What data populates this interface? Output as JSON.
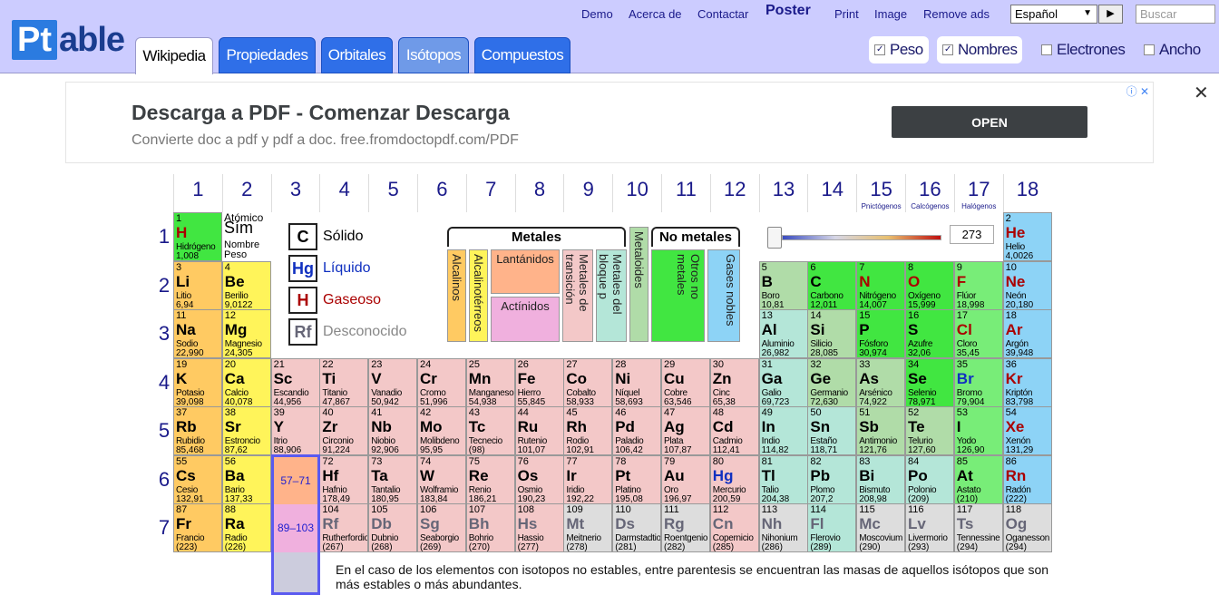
{
  "header": {
    "logo_pt": "Pt",
    "logo_rest": "able",
    "links": [
      "Demo",
      "Acerca de",
      "Contactar"
    ],
    "poster": "Poster",
    "links2": [
      "Print",
      "Image",
      "Remove ads"
    ],
    "language": "Español",
    "search_placeholder": "Buscar",
    "tabs": [
      "Wikipedia",
      "Propiedades",
      "Orbitales",
      "Isótopos",
      "Compuestos"
    ],
    "checks": [
      {
        "label": "Peso",
        "on": true
      },
      {
        "label": "Nombres",
        "on": true
      },
      {
        "label": "Electrones",
        "on": false
      },
      {
        "label": "Ancho",
        "on": false
      }
    ]
  },
  "ad": {
    "title": "Descarga a PDF - Comenzar Descarga",
    "subtitle": "Convierte doc a pdf y pdf a doc. free.fromdoctopdf.com/PDF",
    "button": "OPEN",
    "close": "✕"
  },
  "groups": [
    "1",
    "2",
    "3",
    "4",
    "5",
    "6",
    "7",
    "8",
    "9",
    "10",
    "11",
    "12",
    "13",
    "14",
    "15",
    "16",
    "17",
    "18"
  ],
  "group_sub": {
    "15": "Pnictógenos",
    "16": "Calcógenos",
    "17": "Halógenos"
  },
  "periods": [
    "1",
    "2",
    "3",
    "4",
    "5",
    "6",
    "7"
  ],
  "key": {
    "n": "1",
    "s": "Sím",
    "atomic": "Atómico",
    "name": "Nombre",
    "weight": "Peso"
  },
  "legend": {
    "solid": "Sólido",
    "liquid": "Líquido",
    "gas": "Gaseoso",
    "unknown": "Desconocido",
    "sw": [
      "C",
      "Hg",
      "H",
      "Rf"
    ]
  },
  "categories": {
    "metals": "Metales",
    "nonmetals": "No metales",
    "alk": "Alcalinos",
    "ear": "Alcalinotérreos",
    "lan": "Lantánidos",
    "act": "Actínidos",
    "pm": "Metales de transición",
    "mtl": "Metales del bloque p",
    "metalloids": "Metaloides",
    "ona": "Otros no metales",
    "nob": "Gases nobles"
  },
  "temperature": "273",
  "lan_range": "57–71",
  "act_range": "89–103",
  "note": "En el caso de los elementos con isotopos no estables, entre parentesis se encuentran las masas de aquellos isótopos que son más estables o más abundantes.",
  "elements": [
    [
      "1",
      "H",
      "Hidrógeno",
      "1,008",
      1,
      1,
      "ona",
      "gas"
    ],
    [
      "2",
      "He",
      "Helio",
      "4,0026",
      18,
      1,
      "nob",
      "gas"
    ],
    [
      "3",
      "Li",
      "Litio",
      "6,94",
      1,
      2,
      "alk",
      ""
    ],
    [
      "4",
      "Be",
      "Berilio",
      "9,0122",
      2,
      2,
      "ear",
      ""
    ],
    [
      "5",
      "B",
      "Boro",
      "10,81",
      13,
      2,
      "mtl",
      ""
    ],
    [
      "6",
      "C",
      "Carbono",
      "12,011",
      14,
      2,
      "ona",
      ""
    ],
    [
      "7",
      "N",
      "Nitrógeno",
      "14,007",
      15,
      2,
      "ona",
      "gas"
    ],
    [
      "8",
      "O",
      "Oxígeno",
      "15,999",
      16,
      2,
      "ona",
      "gas"
    ],
    [
      "9",
      "F",
      "Flúor",
      "18,998",
      17,
      2,
      "hal",
      "gas"
    ],
    [
      "10",
      "Ne",
      "Neón",
      "20,180",
      18,
      2,
      "nob",
      "gas"
    ],
    [
      "11",
      "Na",
      "Sodio",
      "22,990",
      1,
      3,
      "alk",
      ""
    ],
    [
      "12",
      "Mg",
      "Magnesio",
      "24,305",
      2,
      3,
      "ear",
      ""
    ],
    [
      "13",
      "Al",
      "Aluminio",
      "26,982",
      13,
      3,
      "pm",
      ""
    ],
    [
      "14",
      "Si",
      "Silicio",
      "28,085",
      14,
      3,
      "mtl",
      ""
    ],
    [
      "15",
      "P",
      "Fósforo",
      "30,974",
      15,
      3,
      "ona",
      ""
    ],
    [
      "16",
      "S",
      "Azufre",
      "32,06",
      16,
      3,
      "ona",
      ""
    ],
    [
      "17",
      "Cl",
      "Cloro",
      "35,45",
      17,
      3,
      "hal",
      "gas"
    ],
    [
      "18",
      "Ar",
      "Argón",
      "39,948",
      18,
      3,
      "nob",
      "gas"
    ],
    [
      "19",
      "K",
      "Potasio",
      "39,098",
      1,
      4,
      "alk",
      ""
    ],
    [
      "20",
      "Ca",
      "Calcio",
      "40,078",
      2,
      4,
      "ear",
      ""
    ],
    [
      "21",
      "Sc",
      "Escandio",
      "44,956",
      3,
      4,
      "tm",
      ""
    ],
    [
      "22",
      "Ti",
      "Titanio",
      "47,867",
      4,
      4,
      "tm",
      ""
    ],
    [
      "23",
      "V",
      "Vanadio",
      "50,942",
      5,
      4,
      "tm",
      ""
    ],
    [
      "24",
      "Cr",
      "Cromo",
      "51,996",
      6,
      4,
      "tm",
      ""
    ],
    [
      "25",
      "Mn",
      "Manganeso",
      "54,938",
      7,
      4,
      "tm",
      ""
    ],
    [
      "26",
      "Fe",
      "Hierro",
      "55,845",
      8,
      4,
      "tm",
      ""
    ],
    [
      "27",
      "Co",
      "Cobalto",
      "58,933",
      9,
      4,
      "tm",
      ""
    ],
    [
      "28",
      "Ni",
      "Níquel",
      "58,693",
      10,
      4,
      "tm",
      ""
    ],
    [
      "29",
      "Cu",
      "Cobre",
      "63,546",
      11,
      4,
      "tm",
      ""
    ],
    [
      "30",
      "Zn",
      "Cinc",
      "65,38",
      12,
      4,
      "tm",
      ""
    ],
    [
      "31",
      "Ga",
      "Galio",
      "69,723",
      13,
      4,
      "pm",
      ""
    ],
    [
      "32",
      "Ge",
      "Germanio",
      "72,630",
      14,
      4,
      "mtl",
      ""
    ],
    [
      "33",
      "As",
      "Arsénico",
      "74,922",
      15,
      4,
      "mtl",
      ""
    ],
    [
      "34",
      "Se",
      "Selenio",
      "78,971",
      16,
      4,
      "ona",
      ""
    ],
    [
      "35",
      "Br",
      "Bromo",
      "79,904",
      17,
      4,
      "hal",
      "liq"
    ],
    [
      "36",
      "Kr",
      "Kriptón",
      "83,798",
      18,
      4,
      "nob",
      "gas"
    ],
    [
      "37",
      "Rb",
      "Rubidio",
      "85,468",
      1,
      5,
      "alk",
      ""
    ],
    [
      "38",
      "Sr",
      "Estroncio",
      "87,62",
      2,
      5,
      "ear",
      ""
    ],
    [
      "39",
      "Y",
      "Itrio",
      "88,906",
      3,
      5,
      "tm",
      ""
    ],
    [
      "40",
      "Zr",
      "Circonio",
      "91,224",
      4,
      5,
      "tm",
      ""
    ],
    [
      "41",
      "Nb",
      "Niobio",
      "92,906",
      5,
      5,
      "tm",
      ""
    ],
    [
      "42",
      "Mo",
      "Molibdeno",
      "95,95",
      6,
      5,
      "tm",
      ""
    ],
    [
      "43",
      "Tc",
      "Tecnecio",
      "(98)",
      7,
      5,
      "tm",
      ""
    ],
    [
      "44",
      "Ru",
      "Rutenio",
      "101,07",
      8,
      5,
      "tm",
      ""
    ],
    [
      "45",
      "Rh",
      "Rodio",
      "102,91",
      9,
      5,
      "tm",
      ""
    ],
    [
      "46",
      "Pd",
      "Paladio",
      "106,42",
      10,
      5,
      "tm",
      ""
    ],
    [
      "47",
      "Ag",
      "Plata",
      "107,87",
      11,
      5,
      "tm",
      ""
    ],
    [
      "48",
      "Cd",
      "Cadmio",
      "112,41",
      12,
      5,
      "tm",
      ""
    ],
    [
      "49",
      "In",
      "Indio",
      "114,82",
      13,
      5,
      "pm",
      ""
    ],
    [
      "50",
      "Sn",
      "Estaño",
      "118,71",
      14,
      5,
      "pm",
      ""
    ],
    [
      "51",
      "Sb",
      "Antimonio",
      "121,76",
      15,
      5,
      "mtl",
      ""
    ],
    [
      "52",
      "Te",
      "Telurio",
      "127,60",
      16,
      5,
      "mtl",
      ""
    ],
    [
      "53",
      "I",
      "Yodo",
      "126,90",
      17,
      5,
      "hal",
      ""
    ],
    [
      "54",
      "Xe",
      "Xenón",
      "131,29",
      18,
      5,
      "nob",
      "gas"
    ],
    [
      "55",
      "Cs",
      "Cesio",
      "132,91",
      1,
      6,
      "alk",
      ""
    ],
    [
      "56",
      "Ba",
      "Bario",
      "137,33",
      2,
      6,
      "ear",
      ""
    ],
    [
      "72",
      "Hf",
      "Hafnio",
      "178,49",
      4,
      6,
      "tm",
      ""
    ],
    [
      "73",
      "Ta",
      "Tantalio",
      "180,95",
      5,
      6,
      "tm",
      ""
    ],
    [
      "74",
      "W",
      "Wolframio",
      "183,84",
      6,
      6,
      "tm",
      ""
    ],
    [
      "75",
      "Re",
      "Renio",
      "186,21",
      7,
      6,
      "tm",
      ""
    ],
    [
      "76",
      "Os",
      "Osmio",
      "190,23",
      8,
      6,
      "tm",
      ""
    ],
    [
      "77",
      "Ir",
      "Iridio",
      "192,22",
      9,
      6,
      "tm",
      ""
    ],
    [
      "78",
      "Pt",
      "Platino",
      "195,08",
      10,
      6,
      "tm",
      ""
    ],
    [
      "79",
      "Au",
      "Oro",
      "196,97",
      11,
      6,
      "tm",
      ""
    ],
    [
      "80",
      "Hg",
      "Mercurio",
      "200,59",
      12,
      6,
      "tm",
      "liq"
    ],
    [
      "81",
      "Tl",
      "Talio",
      "204,38",
      13,
      6,
      "pm",
      ""
    ],
    [
      "82",
      "Pb",
      "Plomo",
      "207,2",
      14,
      6,
      "pm",
      ""
    ],
    [
      "83",
      "Bi",
      "Bismuto",
      "208,98",
      15,
      6,
      "pm",
      ""
    ],
    [
      "84",
      "Po",
      "Polonio",
      "(209)",
      16,
      6,
      "pm",
      ""
    ],
    [
      "85",
      "At",
      "Astato",
      "(210)",
      17,
      6,
      "hal",
      ""
    ],
    [
      "86",
      "Rn",
      "Radón",
      "(222)",
      18,
      6,
      "nob",
      "gas"
    ],
    [
      "87",
      "Fr",
      "Francio",
      "(223)",
      1,
      7,
      "alk",
      ""
    ],
    [
      "88",
      "Ra",
      "Radio",
      "(226)",
      2,
      7,
      "ear",
      ""
    ],
    [
      "104",
      "Rf",
      "Rutherfordio",
      "(267)",
      4,
      7,
      "tm",
      "unk"
    ],
    [
      "105",
      "Db",
      "Dubnio",
      "(268)",
      5,
      7,
      "tm",
      "unk"
    ],
    [
      "106",
      "Sg",
      "Seaborgio",
      "(269)",
      6,
      7,
      "tm",
      "unk"
    ],
    [
      "107",
      "Bh",
      "Bohrio",
      "(270)",
      7,
      7,
      "tm",
      "unk"
    ],
    [
      "108",
      "Hs",
      "Hassio",
      "(277)",
      8,
      7,
      "tm",
      "unk"
    ],
    [
      "109",
      "Mt",
      "Meitnerio",
      "(278)",
      9,
      7,
      "unk",
      "unk"
    ],
    [
      "110",
      "Ds",
      "Darmstadtio",
      "(281)",
      10,
      7,
      "unk",
      "unk"
    ],
    [
      "111",
      "Rg",
      "Roentgenio",
      "(282)",
      11,
      7,
      "unk",
      "unk"
    ],
    [
      "112",
      "Cn",
      "Copernicio",
      "(285)",
      12,
      7,
      "tm",
      "unk"
    ],
    [
      "113",
      "Nh",
      "Nihonium",
      "(286)",
      13,
      7,
      "unk",
      "unk"
    ],
    [
      "114",
      "Fl",
      "Flerovio",
      "(289)",
      14,
      7,
      "pm",
      "unk"
    ],
    [
      "115",
      "Mc",
      "Moscovium",
      "(290)",
      15,
      7,
      "unk",
      "unk"
    ],
    [
      "116",
      "Lv",
      "Livermorio",
      "(293)",
      16,
      7,
      "unk",
      "unk"
    ],
    [
      "117",
      "Ts",
      "Tennessine",
      "(294)",
      17,
      7,
      "unk",
      "unk"
    ],
    [
      "118",
      "Og",
      "Oganesson",
      "(294)",
      18,
      7,
      "unk",
      "unk"
    ]
  ]
}
